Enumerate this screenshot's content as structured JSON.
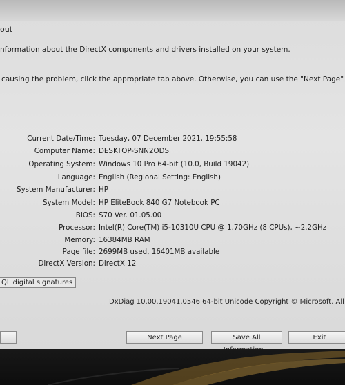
{
  "header": {
    "section_tail": "out",
    "intro_line": "nformation about the DirectX components and drivers installed on your system.",
    "help_line": "causing the problem, click the appropriate tab above.  Otherwise, you can use the \"Next Page\" button be"
  },
  "system_info": [
    {
      "label": "Current Date/Time:",
      "value": "Tuesday, 07 December 2021, 19:55:58"
    },
    {
      "label": "Computer Name:",
      "value": "DESKTOP-SNN2ODS"
    },
    {
      "label": "Operating System:",
      "value": "Windows 10 Pro 64-bit (10.0, Build 19042)"
    },
    {
      "label": "Language:",
      "value": "English (Regional Setting: English)"
    },
    {
      "label": "System Manufacturer:",
      "value": "HP"
    },
    {
      "label": "System Model:",
      "value": "HP EliteBook 840 G7 Notebook PC"
    },
    {
      "label": "BIOS:",
      "value": "S70 Ver. 01.05.00"
    },
    {
      "label": "Processor:",
      "value": "Intel(R) Core(TM) i5-10310U CPU @ 1.70GHz (8 CPUs), ~2.2GHz"
    },
    {
      "label": "Memory:",
      "value": "16384MB RAM"
    },
    {
      "label": "Page file:",
      "value": "2699MB used, 16401MB available"
    },
    {
      "label": "DirectX Version:",
      "value": "DirectX 12"
    }
  ],
  "checkbox": {
    "label": "QL digital signatures"
  },
  "footer": {
    "version_text": "DxDiag 10.00.19041.0546 64-bit Unicode  Copyright © Microsoft. All rights rese"
  },
  "buttons": {
    "left": "",
    "next_page": "Next Page",
    "save_all": "Save All Information...",
    "exit": "Exit"
  }
}
